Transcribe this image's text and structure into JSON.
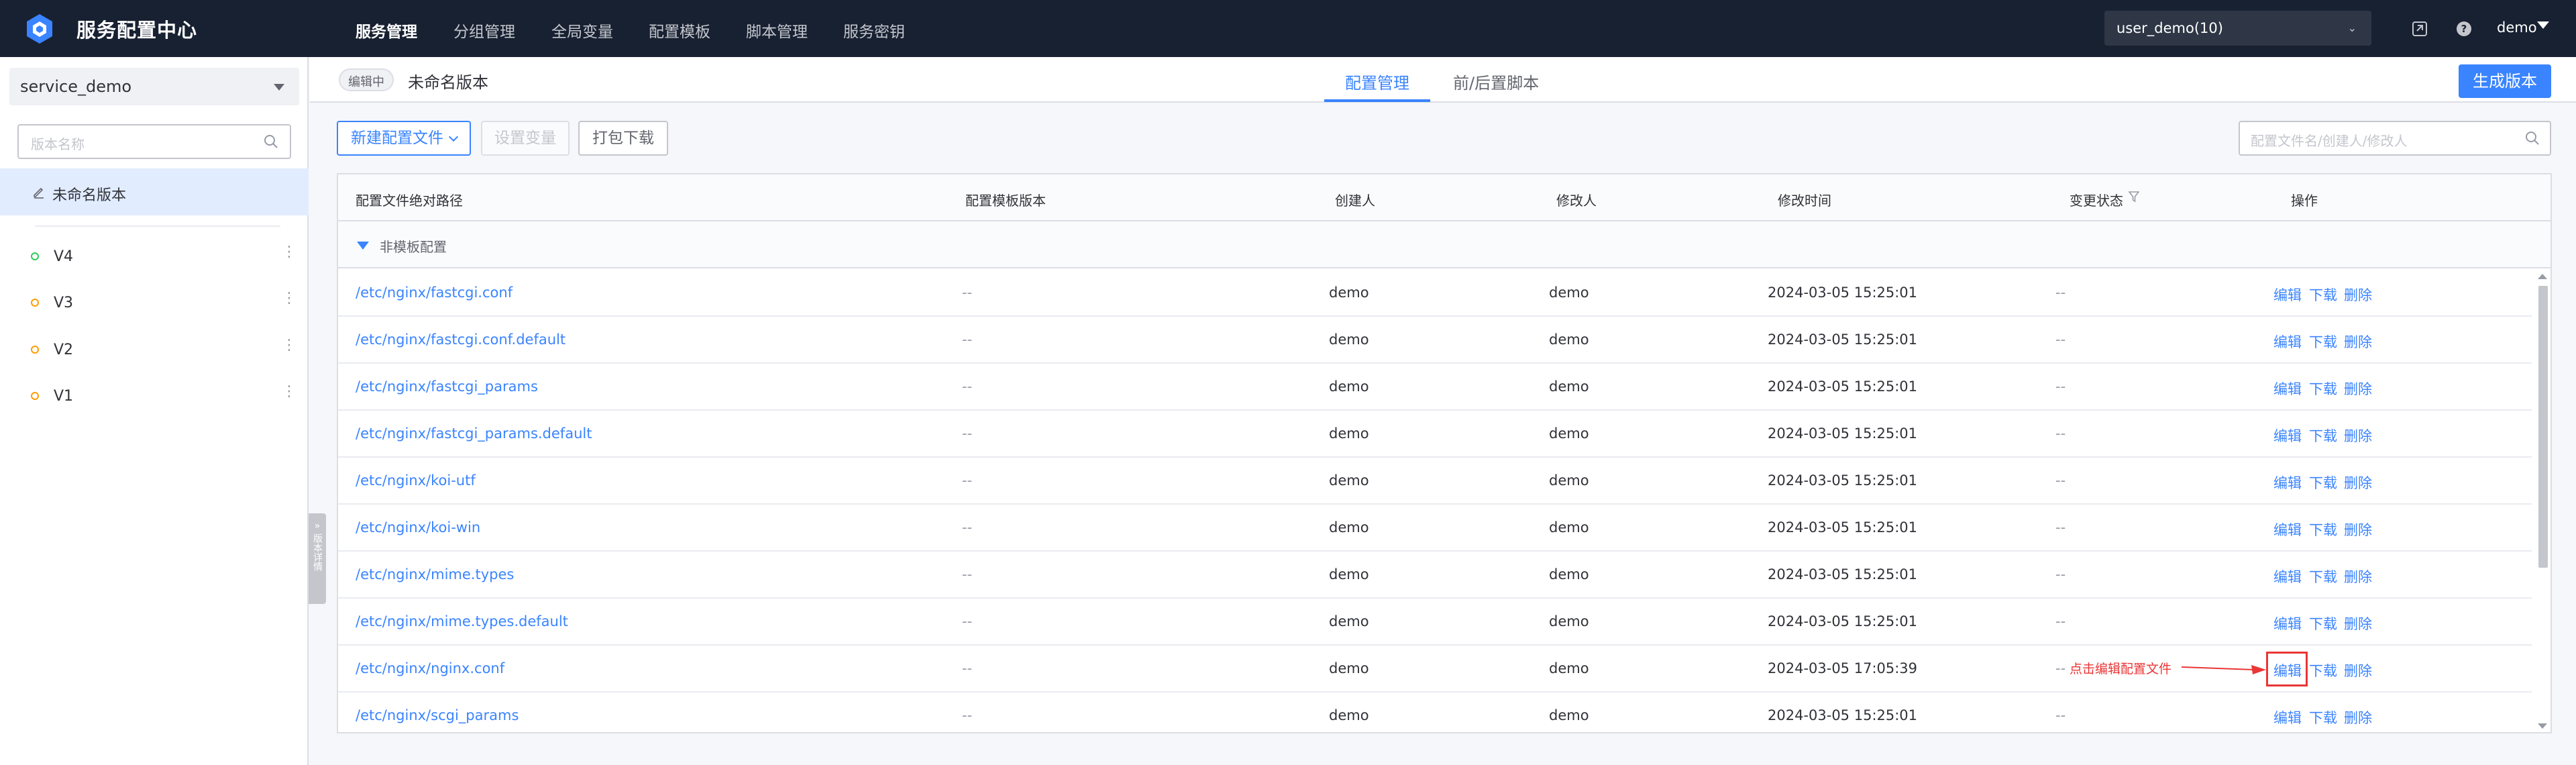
{
  "app": {
    "brand": "服务配置中心",
    "nav": [
      "服务管理",
      "分组管理",
      "全局变量",
      "配置模板",
      "脚本管理",
      "服务密钥"
    ],
    "nav_active_index": 0,
    "business": "user_demo(10)",
    "user": "demo"
  },
  "sidebar": {
    "service": "service_demo",
    "search_placeholder": "版本名称",
    "current": "未命名版本",
    "versions": [
      {
        "name": "V4",
        "dot_color": "#2dcb56"
      },
      {
        "name": "V3",
        "dot_color": "#ff9c01"
      },
      {
        "name": "V2",
        "dot_color": "#ff9c01"
      },
      {
        "name": "V1",
        "dot_color": "#ff9c01"
      }
    ],
    "collapse_label": "版本详情"
  },
  "header": {
    "status_tag": "编辑中",
    "version_title": "未命名版本",
    "tabs": [
      "配置管理",
      "前/后置脚本"
    ],
    "active_tab_index": 0,
    "publish_button": "生成版本"
  },
  "toolbar": {
    "new_config": "新建配置文件",
    "set_variables": "设置变量",
    "pack_download": "打包下载",
    "search_placeholder": "配置文件名/创建人/修改人"
  },
  "table": {
    "columns": [
      "配置文件绝对路径",
      "配置模板版本",
      "创建人",
      "修改人",
      "修改时间",
      "变更状态",
      "操作"
    ],
    "group_label": "非模板配置",
    "actions": [
      "编辑",
      "下载",
      "删除"
    ],
    "rows": [
      {
        "path": "/etc/nginx/fastcgi.conf",
        "template": "--",
        "creator": "demo",
        "modifier": "demo",
        "time": "2024-03-05 15:25:01",
        "status": "--"
      },
      {
        "path": "/etc/nginx/fastcgi.conf.default",
        "template": "--",
        "creator": "demo",
        "modifier": "demo",
        "time": "2024-03-05 15:25:01",
        "status": "--"
      },
      {
        "path": "/etc/nginx/fastcgi_params",
        "template": "--",
        "creator": "demo",
        "modifier": "demo",
        "time": "2024-03-05 15:25:01",
        "status": "--"
      },
      {
        "path": "/etc/nginx/fastcgi_params.default",
        "template": "--",
        "creator": "demo",
        "modifier": "demo",
        "time": "2024-03-05 15:25:01",
        "status": "--"
      },
      {
        "path": "/etc/nginx/koi-utf",
        "template": "--",
        "creator": "demo",
        "modifier": "demo",
        "time": "2024-03-05 15:25:01",
        "status": "--"
      },
      {
        "path": "/etc/nginx/koi-win",
        "template": "--",
        "creator": "demo",
        "modifier": "demo",
        "time": "2024-03-05 15:25:01",
        "status": "--"
      },
      {
        "path": "/etc/nginx/mime.types",
        "template": "--",
        "creator": "demo",
        "modifier": "demo",
        "time": "2024-03-05 15:25:01",
        "status": "--"
      },
      {
        "path": "/etc/nginx/mime.types.default",
        "template": "--",
        "creator": "demo",
        "modifier": "demo",
        "time": "2024-03-05 15:25:01",
        "status": "--"
      },
      {
        "path": "/etc/nginx/nginx.conf",
        "template": "--",
        "creator": "demo",
        "modifier": "demo",
        "time": "2024-03-05 17:05:39",
        "status": "--"
      },
      {
        "path": "/etc/nginx/scgi_params",
        "template": "--",
        "creator": "demo",
        "modifier": "demo",
        "time": "2024-03-05 15:25:01",
        "status": "--"
      }
    ]
  },
  "annotation": {
    "text": "点击编辑配置文件",
    "color": "#ea3636"
  },
  "colors": {
    "accent": "#3a84ff",
    "nav_bg": "#182132",
    "danger": "#ea3636"
  }
}
